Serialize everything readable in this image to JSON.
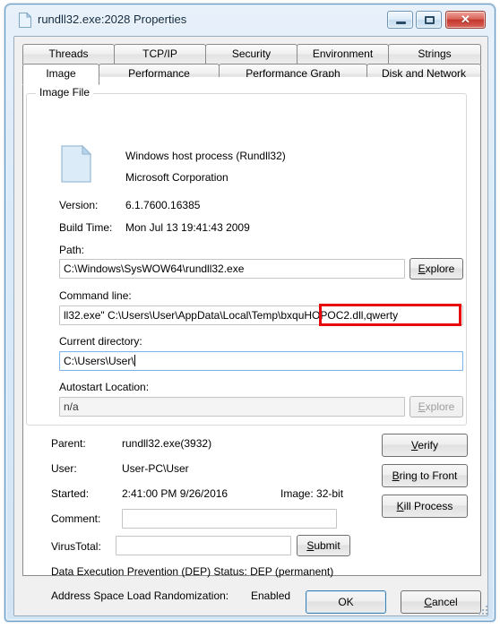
{
  "window": {
    "title": "rundll32.exe:2028 Properties",
    "icon": "document-icon",
    "controls": {
      "minimize": "minimize-icon",
      "maximize": "maximize-icon",
      "close": "✕"
    }
  },
  "tabs": {
    "row_top": [
      {
        "label": "Threads",
        "selected": false
      },
      {
        "label": "TCP/IP",
        "selected": false
      },
      {
        "label": "Security",
        "selected": false
      },
      {
        "label": "Environment",
        "selected": false
      },
      {
        "label": "Strings",
        "selected": false
      }
    ],
    "row_bottom": [
      {
        "label": "Image",
        "selected": true
      },
      {
        "label": "Performance",
        "selected": false
      },
      {
        "label": "Performance Graph",
        "selected": false
      },
      {
        "label": "Disk and Network",
        "selected": false
      }
    ]
  },
  "image_file": {
    "legend": "Image File",
    "description": "Windows host process (Rundll32)",
    "company": "Microsoft Corporation",
    "version_label": "Version:",
    "version_value": "6.1.7600.16385",
    "build_time_label": "Build Time:",
    "build_time_value": "Mon Jul 13 19:41:43 2009",
    "path_label": "Path:",
    "path_value": "C:\\Windows\\SysWOW64\\rundll32.exe",
    "path_explore_label": "Explore",
    "command_line_label": "Command line:",
    "command_line_value": "ll32.exe\" C:\\Users\\User\\AppData\\Local\\Temp\\bxquHOPOC2.dll,qwerty",
    "command_line_highlight": "\\bxquHOPOC2.dll,qwerty",
    "current_directory_label": "Current directory:",
    "current_directory_value": "C:\\Users\\User\\",
    "autostart_label": "Autostart Location:",
    "autostart_value": "n/a",
    "autostart_explore_label": "Explore"
  },
  "process_info": {
    "parent_label": "Parent:",
    "parent_value": "rundll32.exe(3932)",
    "user_label": "User:",
    "user_value": "User-PC\\User",
    "started_label": "Started:",
    "started_value": "2:41:00 PM  9/26/2016",
    "image_bits": "Image: 32-bit",
    "comment_label": "Comment:",
    "comment_value": "",
    "virustotal_label": "VirusTotal:",
    "virustotal_value": "",
    "submit_label": "Submit",
    "dep_text": "Data Execution Prevention (DEP) Status: DEP (permanent)",
    "aslr_label": "Address Space Load Randomization:",
    "aslr_value": "Enabled"
  },
  "action_buttons": {
    "verify": "Verify",
    "bring_to_front": "Bring to Front",
    "kill_process": "Kill Process"
  },
  "dialog_buttons": {
    "ok": "OK",
    "cancel": "Cancel"
  },
  "colors": {
    "highlight_red": "#e8070b",
    "titlebar_blue": "#cfe2f2",
    "close_red": "#c3372c"
  }
}
